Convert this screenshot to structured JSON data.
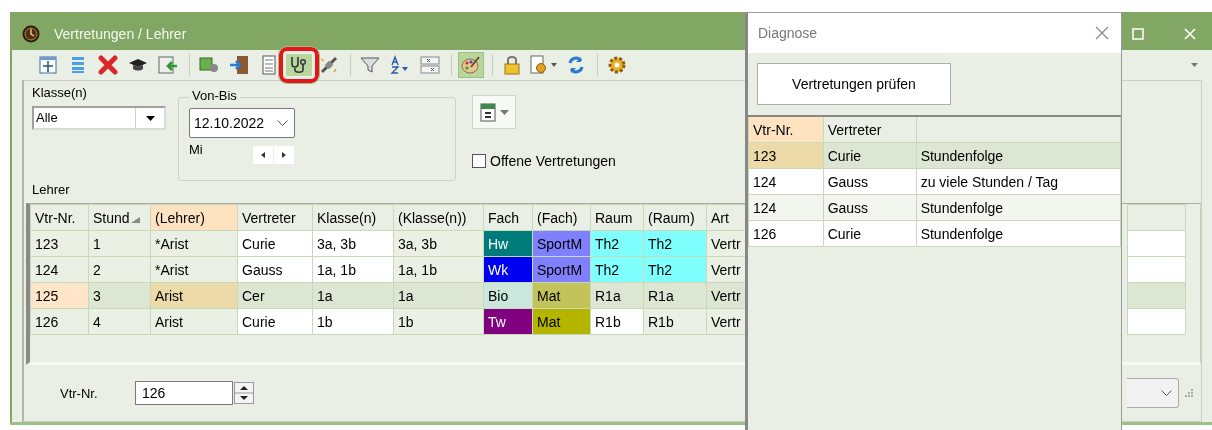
{
  "window": {
    "title": "Vertretungen / Lehrer"
  },
  "toolbar": [
    [
      {
        "kind": "move",
        "on": false,
        "marked": false
      },
      {
        "kind": "list",
        "on": false,
        "marked": false
      },
      {
        "kind": "delete",
        "on": false,
        "marked": false
      },
      {
        "kind": "cap",
        "on": false,
        "marked": false
      },
      {
        "kind": "import",
        "on": false,
        "marked": false
      }
    ],
    [
      {
        "kind": "money",
        "on": false,
        "marked": false
      },
      {
        "kind": "door",
        "on": false,
        "marked": false
      },
      {
        "kind": "calculator",
        "on": false,
        "marked": false
      },
      {
        "kind": "stethoscope",
        "on": true,
        "marked": true
      },
      {
        "kind": "plug",
        "on": false,
        "marked": false
      }
    ],
    [
      {
        "kind": "filter",
        "on": false,
        "marked": false
      },
      {
        "kind": "sort",
        "on": false,
        "marked": false
      },
      {
        "kind": "fields",
        "on": false,
        "marked": false
      }
    ],
    [
      {
        "kind": "palette",
        "on": true,
        "marked": false
      }
    ],
    [
      {
        "kind": "lock",
        "on": false,
        "marked": false
      },
      {
        "kind": "docgear",
        "on": false,
        "marked": false
      },
      {
        "kind": "refresh",
        "on": false,
        "marked": false
      }
    ],
    [
      {
        "kind": "gear",
        "on": false,
        "marked": false
      }
    ]
  ],
  "filter": {
    "class_label": "Klasse(n)",
    "class_value": "Alle",
    "range_label": "Von-Bis",
    "date": "12.10.2022",
    "weekday": "Mi",
    "open_only": {
      "label": "Offene Vertretungen",
      "checked": false
    },
    "teacher_label": "Lehrer"
  },
  "grid": {
    "columns": [
      {
        "label": "Vtr-Nr.",
        "kind": "fixed",
        "selected": false,
        "sorted": false
      },
      {
        "label": "Stund",
        "kind": "fixed",
        "selected": false,
        "sorted": true
      },
      {
        "label": "(Lehrer)",
        "kind": "fixed",
        "selected": true,
        "sorted": false
      },
      {
        "label": "Vertreter",
        "kind": "edit",
        "selected": false,
        "sorted": false
      },
      {
        "label": "Klasse(n)",
        "kind": "edit",
        "selected": false,
        "sorted": false
      },
      {
        "label": "(Klasse(n))",
        "kind": "fixed",
        "selected": false,
        "sorted": false
      },
      {
        "label": "Fach",
        "selected": false,
        "sorted": false
      },
      {
        "label": "(Fach)",
        "selected": false,
        "sorted": false
      },
      {
        "label": "Raum",
        "kind": "edit",
        "selected": false,
        "sorted": false
      },
      {
        "label": "(Raum)",
        "kind": "fixed",
        "selected": false,
        "sorted": false
      },
      {
        "label": "Art",
        "kind": "fixed",
        "selected": false,
        "sorted": false
      }
    ],
    "rows": [
      {
        "selected": false,
        "cells": [
          {
            "text": "123"
          },
          {
            "text": "1"
          },
          {
            "text": "*Arist"
          },
          {
            "text": "Curie"
          },
          {
            "text": "3a, 3b"
          },
          {
            "text": "3a, 3b"
          },
          {
            "text": "Hw",
            "color": "#007b7b"
          },
          {
            "text": "SportM",
            "color": "#8080ff"
          },
          {
            "text": "Th2",
            "color": "#80ffff"
          },
          {
            "text": "Th2",
            "color": "#80ffff"
          },
          {
            "text": "Vertr"
          }
        ]
      },
      {
        "selected": false,
        "cells": [
          {
            "text": "124"
          },
          {
            "text": "2"
          },
          {
            "text": "*Arist"
          },
          {
            "text": "Gauss"
          },
          {
            "text": "1a, 1b"
          },
          {
            "text": "1a, 1b"
          },
          {
            "text": "Wk",
            "color": "#0000f0"
          },
          {
            "text": "SportM",
            "color": "#8080ff"
          },
          {
            "text": "Th2",
            "color": "#80ffff"
          },
          {
            "text": "Th2",
            "color": "#80ffff"
          },
          {
            "text": "Vertr"
          }
        ]
      },
      {
        "selected": true,
        "cells": [
          {
            "text": "125"
          },
          {
            "text": "3"
          },
          {
            "text": "Arist"
          },
          {
            "text": "Cer"
          },
          {
            "text": "1a"
          },
          {
            "text": "1a"
          },
          {
            "text": "Bio",
            "color": "#cbe6da"
          },
          {
            "text": "Mat",
            "color": "#c2c35a"
          },
          {
            "text": "R1a"
          },
          {
            "text": "R1a"
          },
          {
            "text": "Vertr"
          }
        ]
      },
      {
        "selected": false,
        "cells": [
          {
            "text": "126"
          },
          {
            "text": "4"
          },
          {
            "text": "Arist"
          },
          {
            "text": "Curie"
          },
          {
            "text": "1b"
          },
          {
            "text": "1b"
          },
          {
            "text": "Tw",
            "color": "#800080"
          },
          {
            "text": "Mat",
            "color": "#b5b500"
          },
          {
            "text": "R1b"
          },
          {
            "text": "R1b"
          },
          {
            "text": "Vertr"
          }
        ]
      }
    ]
  },
  "footer": {
    "label": "Vtr-Nr.",
    "value": "126"
  },
  "diagnose": {
    "title": "Diagnose",
    "button": "Vertretungen prüfen",
    "columns": [
      {
        "label": "Vtr-Nr.",
        "selected": true
      },
      {
        "label": "Vertreter",
        "selected": false
      }
    ],
    "rows": [
      {
        "selected": true,
        "cells": [
          "123",
          "Curie",
          "Stundenfolge"
        ]
      },
      {
        "selected": false,
        "cells": [
          "124",
          "Gauss",
          "zu viele Stunden / Tag"
        ]
      },
      {
        "selected": false,
        "cells": [
          "124",
          "Gauss",
          "Stundenfolge"
        ]
      },
      {
        "selected": false,
        "cells": [
          "126",
          "Curie",
          "Stundenfolge"
        ]
      }
    ]
  }
}
